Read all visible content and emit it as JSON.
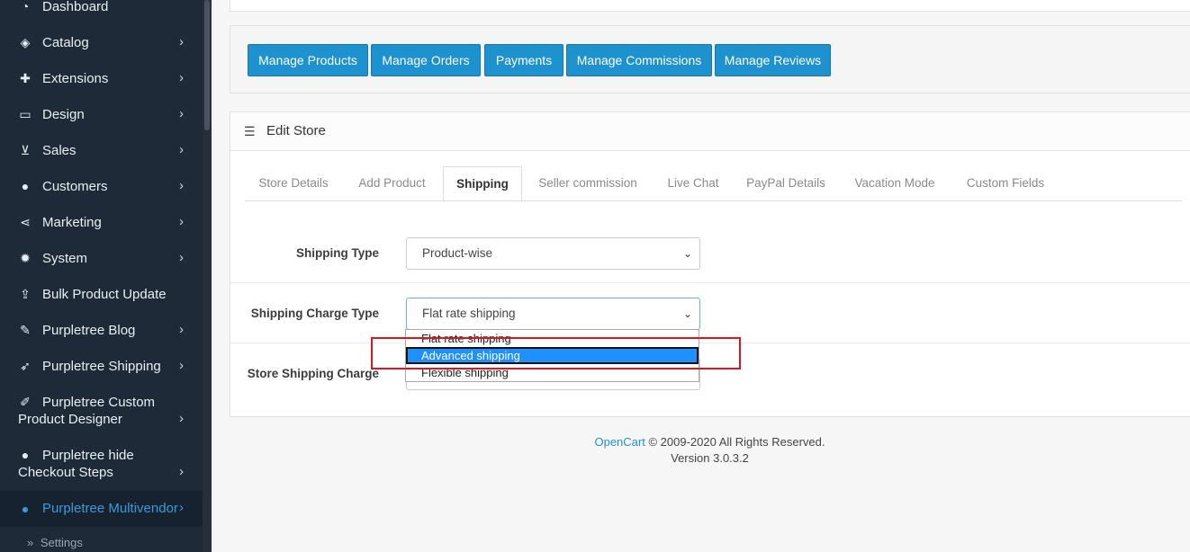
{
  "sidebar": {
    "items": [
      {
        "icon": "dashboard-icon",
        "label": "Dashboard",
        "chevron": false
      },
      {
        "icon": "tags-icon",
        "label": "Catalog",
        "chevron": true
      },
      {
        "icon": "puzzle-icon",
        "label": "Extensions",
        "chevron": true
      },
      {
        "icon": "monitor-icon",
        "label": "Design",
        "chevron": true
      },
      {
        "icon": "cart-icon",
        "label": "Sales",
        "chevron": true
      },
      {
        "icon": "user-icon",
        "label": "Customers",
        "chevron": true
      },
      {
        "icon": "share-icon",
        "label": "Marketing",
        "chevron": true
      },
      {
        "icon": "gear-icon",
        "label": "System",
        "chevron": true
      },
      {
        "icon": "upload-icon",
        "label": "Bulk Product Update",
        "chevron": false
      },
      {
        "icon": "edit-icon",
        "label": "Purpletree Blog",
        "chevron": true
      },
      {
        "icon": "rocket-icon",
        "label": "Purpletree Shipping",
        "chevron": true
      },
      {
        "icon": "brush-icon",
        "label": "Purpletree Custom Product Designer",
        "chevron": true
      },
      {
        "icon": "user-icon",
        "label": "Purpletree hide Checkout Steps",
        "chevron": true
      },
      {
        "icon": "user-icon",
        "label": "Purpletree Multivendor",
        "chevron": true,
        "active": true
      }
    ],
    "sub_items": [
      {
        "label": "Settings"
      }
    ],
    "chevron_glyph": "›",
    "sub_prefix": "»"
  },
  "toolbar": {
    "buttons": [
      "Manage Products",
      "Manage Orders",
      "Payments",
      "Manage Commissions",
      "Manage Reviews"
    ]
  },
  "panel": {
    "title": "Edit Store",
    "tabs": [
      "Store Details",
      "Add Product",
      "Shipping",
      "Seller commission",
      "Live Chat",
      "PayPal Details",
      "Vacation Mode",
      "Custom Fields"
    ],
    "active_tab": "Shipping"
  },
  "form": {
    "shipping_type_label": "Shipping Type",
    "shipping_type_value": "Product-wise",
    "charge_type_label": "Shipping Charge Type",
    "charge_type_value": "Flat rate shipping",
    "store_charge_label": "Store Shipping Charge",
    "dropdown_options": [
      "Flat rate shipping",
      "Advanced shipping",
      "Flexible shipping"
    ],
    "highlighted_option": "Advanced shipping"
  },
  "footer": {
    "link": "OpenCart",
    "copyright": " © 2009-2020 All Rights Reserved.",
    "version": "Version 3.0.3.2"
  },
  "colors": {
    "sidebar_bg": "#1e2a38",
    "accent": "#1e91cf",
    "active_nav": "#3b9bd8",
    "highlight_box": "#e0151b",
    "option_highlight": "#1e90ff"
  }
}
